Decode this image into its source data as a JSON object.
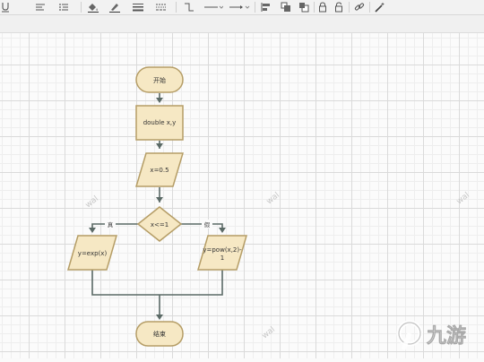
{
  "toolbar": {
    "icons": [
      "font-underline-icon",
      "align-left-icon",
      "list-indent-icon",
      "fill-color-icon",
      "line-color-icon",
      "line-weight-icon",
      "dash-style-icon",
      "waypoint-icon",
      "connection-style-icon",
      "arrow-style-icon",
      "align-objects-icon",
      "bring-front-icon",
      "send-back-icon",
      "lock-icon",
      "unlock-icon",
      "link-icon",
      "magic-wand-icon"
    ]
  },
  "diagram": {
    "start": "开始",
    "declare": "double x,y",
    "assign": "x=0.5",
    "condition": "x<=1",
    "true_label": "真",
    "false_label": "假",
    "true_branch": "y=exp(x)",
    "false_branch_line1": "y=pow(x,2)-",
    "false_branch_line2": "1",
    "end": "结束",
    "colors": {
      "node_fill": "#f6e8c4",
      "node_stroke": "#b59d66",
      "edge": "#5b6a66"
    }
  },
  "watermarks": [
    "wal",
    "wal",
    "wal",
    "wal"
  ],
  "brand": {
    "logo_text": "九游"
  }
}
